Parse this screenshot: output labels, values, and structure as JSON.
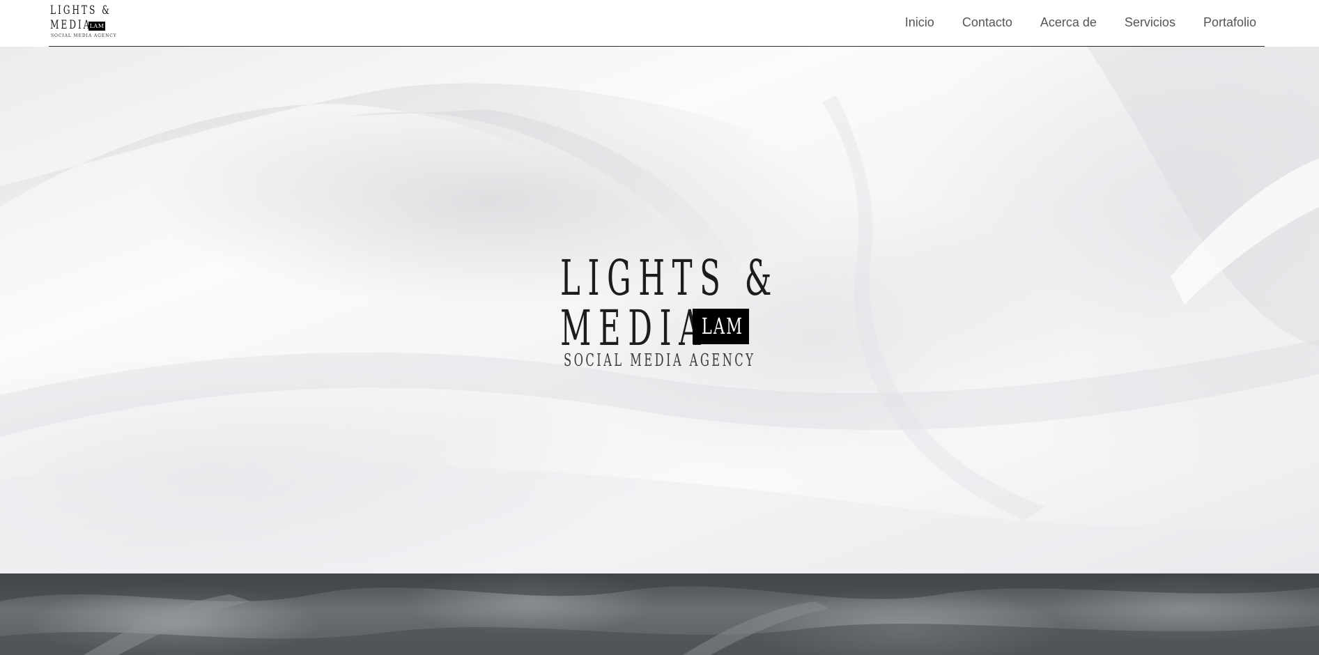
{
  "brand": {
    "line1": "LIGHTS &",
    "line2": "MEDIA",
    "badge": "LAM",
    "tagline": "SOCIAL MEDIA AGENCY"
  },
  "nav": {
    "items": [
      {
        "label": "Inicio"
      },
      {
        "label": "Contacto"
      },
      {
        "label": "Acerca de"
      },
      {
        "label": "Servicios"
      },
      {
        "label": "Portafolio"
      }
    ]
  },
  "hero": {
    "line1": "LIGHTS &",
    "line2": "MEDIA",
    "badge": "LAM",
    "tagline": "SOCIAL MEDIA AGENCY"
  },
  "colors": {
    "nav_text": "#555555",
    "logo_ink": "#1c1c1c",
    "band_dark": "#4a4d52"
  }
}
